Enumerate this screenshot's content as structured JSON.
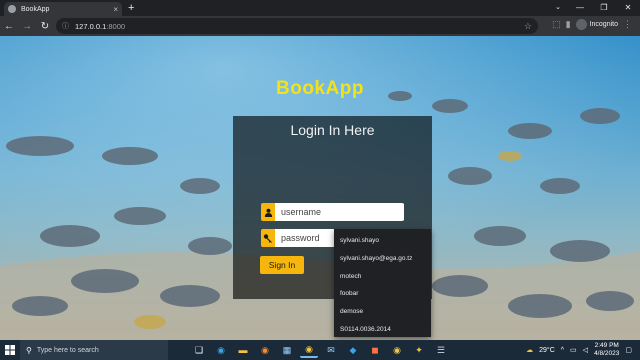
{
  "browser": {
    "tab_title": "BookApp",
    "new_tab_label": "+",
    "url_host": "127.0.0.1",
    "url_port": ":8000",
    "profile_label": "Incognito",
    "window_controls": {
      "minimize": "—",
      "restore": "❐",
      "close": "✕"
    }
  },
  "page": {
    "app_title": "BookApp",
    "login": {
      "heading": "Login In Here",
      "username_placeholder": "username",
      "password_placeholder": "password",
      "signin_label": "Sign In"
    },
    "autocomplete": [
      "sylvani.shayo",
      "sylvani.shayo@ega.go.tz",
      "motech",
      "foobar",
      "demose",
      "S0114.0036.2014"
    ]
  },
  "taskbar": {
    "search_placeholder": "Type here to search",
    "weather": "29°C",
    "time": "2:49 PM",
    "date": "4/8/2023"
  },
  "colors": {
    "accent": "#f6b60b",
    "title_yellow": "#f3e21b",
    "login_overlay": "rgba(0,0,0,0.62)"
  }
}
